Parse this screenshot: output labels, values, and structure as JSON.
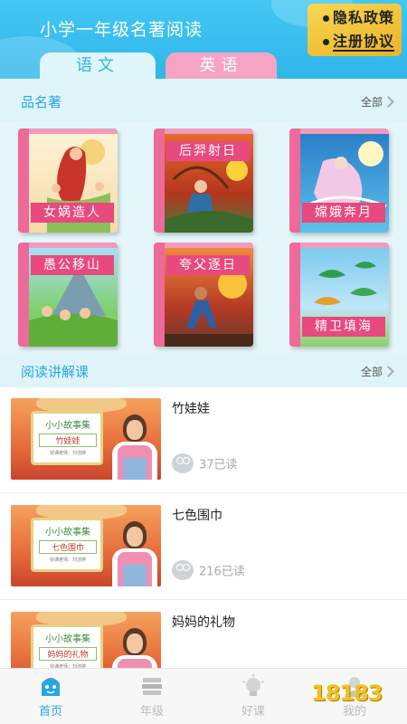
{
  "header": {
    "title": "小学一年级名著阅读",
    "policy_links": [
      "隐私政策",
      "注册协议"
    ]
  },
  "tabs": [
    {
      "label": "语文",
      "active": false
    },
    {
      "label": "英语",
      "active": true
    }
  ],
  "classics": {
    "title": "品名著",
    "see_all": "全部",
    "books": [
      {
        "title": "女娲造人",
        "label_position": "bottom",
        "scene": "goddess"
      },
      {
        "title": "后羿射日",
        "label_position": "top",
        "scene": "archer"
      },
      {
        "title": "嫦娥奔月",
        "label_position": "bottom",
        "scene": "moon"
      },
      {
        "title": "愚公移山",
        "label_position": "top",
        "scene": "mountain"
      },
      {
        "title": "夸父逐日",
        "label_position": "top",
        "scene": "runner"
      },
      {
        "title": "精卫填海",
        "label_position": "bottom",
        "scene": "birds"
      }
    ]
  },
  "reading_course": {
    "title": "阅读讲解课",
    "see_all": "全部",
    "lessons": [
      {
        "title": "竹娃娃",
        "board_title": "小小故事集",
        "board_sub": "竹娃娃",
        "teacher": "授课老师：刘洁婷",
        "reads": "37已读"
      },
      {
        "title": "七色围巾",
        "board_title": "小小故事集",
        "board_sub": "七色围巾",
        "teacher": "授课老师：刘洁婷",
        "reads": "216已读"
      },
      {
        "title": "妈妈的礼物",
        "board_title": "小小故事集",
        "board_sub": "妈妈的礼物",
        "teacher": "授课老师：刘洁婷",
        "reads": ""
      }
    ]
  },
  "bottom_nav": [
    {
      "label": "首页",
      "icon": "home-icon",
      "active": true
    },
    {
      "label": "年级",
      "icon": "books-icon",
      "active": false
    },
    {
      "label": "好课",
      "icon": "lightbulb-icon",
      "active": false
    },
    {
      "label": "我的",
      "icon": "profile-icon",
      "active": false
    }
  ],
  "watermark": "18183",
  "colors": {
    "header": "#2fb6ea",
    "accent": "#27a7e0",
    "pink": "#e8497f"
  }
}
